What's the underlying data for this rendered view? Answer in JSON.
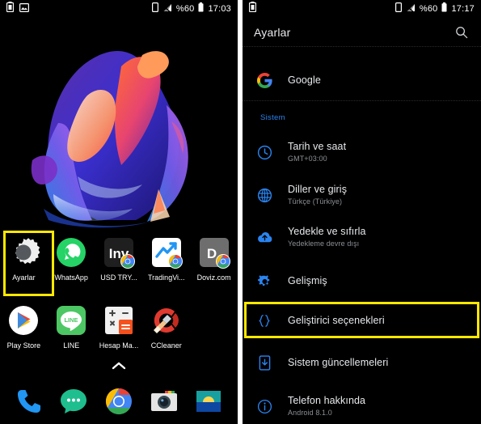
{
  "home": {
    "statusbar": {
      "left_icons": [
        "battery-saver-icon",
        "screenshot-image-icon"
      ],
      "right_icons": [
        "sim-card-icon",
        "signal-bars-icon",
        "battery-icon"
      ],
      "battery_percent": "%60",
      "clock": "17:03"
    },
    "apps_row1": [
      {
        "label": "Ayarlar",
        "icon": "settings-gear-icon"
      },
      {
        "label": "WhatsApp",
        "icon": "whatsapp-icon"
      },
      {
        "label": "USD TRY...",
        "icon": "investing-icon"
      },
      {
        "label": "TradingVi...",
        "icon": "tradingview-icon"
      },
      {
        "label": "Doviz.com",
        "icon": "doviz-icon"
      }
    ],
    "apps_row2": [
      {
        "label": "Play Store",
        "icon": "play-store-icon"
      },
      {
        "label": "LINE",
        "icon": "line-icon"
      },
      {
        "label": "Hesap Ma...",
        "icon": "calculator-icon"
      },
      {
        "label": "CCleaner",
        "icon": "ccleaner-icon"
      }
    ],
    "dock": [
      {
        "label": "Phone",
        "icon": "phone-icon"
      },
      {
        "label": "Messages",
        "icon": "messages-icon"
      },
      {
        "label": "Chrome",
        "icon": "chrome-icon"
      },
      {
        "label": "Camera",
        "icon": "camera-icon"
      },
      {
        "label": "Gallery",
        "icon": "gallery-icon"
      }
    ],
    "drawer_arrow": "chevron-up-icon",
    "highlight_color": "#ffe800",
    "highlighted_app": "Ayarlar"
  },
  "settings": {
    "statusbar": {
      "left_icons": [
        "battery-saver-icon"
      ],
      "right_icons": [
        "sim-card-icon",
        "signal-bars-icon",
        "battery-icon"
      ],
      "battery_percent": "%60",
      "clock": "17:17"
    },
    "title": "Ayarlar",
    "search_icon": "search-icon",
    "google_row": {
      "title": "Google",
      "icon": "google-g-icon"
    },
    "section_label": "Sistem",
    "items": [
      {
        "title": "Tarih ve saat",
        "subtitle": "GMT+03:00",
        "icon": "clock-icon"
      },
      {
        "title": "Diller ve giriş",
        "subtitle": "Türkçe (Türkiye)",
        "icon": "globe-icon"
      },
      {
        "title": "Yedekle ve sıfırla",
        "subtitle": "Yedekleme devre dışı",
        "icon": "cloud-upload-icon"
      },
      {
        "title": "Gelişmiş",
        "subtitle": "",
        "icon": "gear-icon"
      },
      {
        "title": "Geliştirici seçenekleri",
        "subtitle": "",
        "icon": "braces-icon"
      },
      {
        "title": "Sistem güncellemeleri",
        "subtitle": "",
        "icon": "system-update-icon"
      },
      {
        "title": "Telefon hakkında",
        "subtitle": "Android 8.1.0",
        "icon": "info-icon"
      }
    ],
    "highlight_color": "#ffe800",
    "highlighted_item": "Geliştirici seçenekleri",
    "accent_color": "#2a84f0"
  }
}
